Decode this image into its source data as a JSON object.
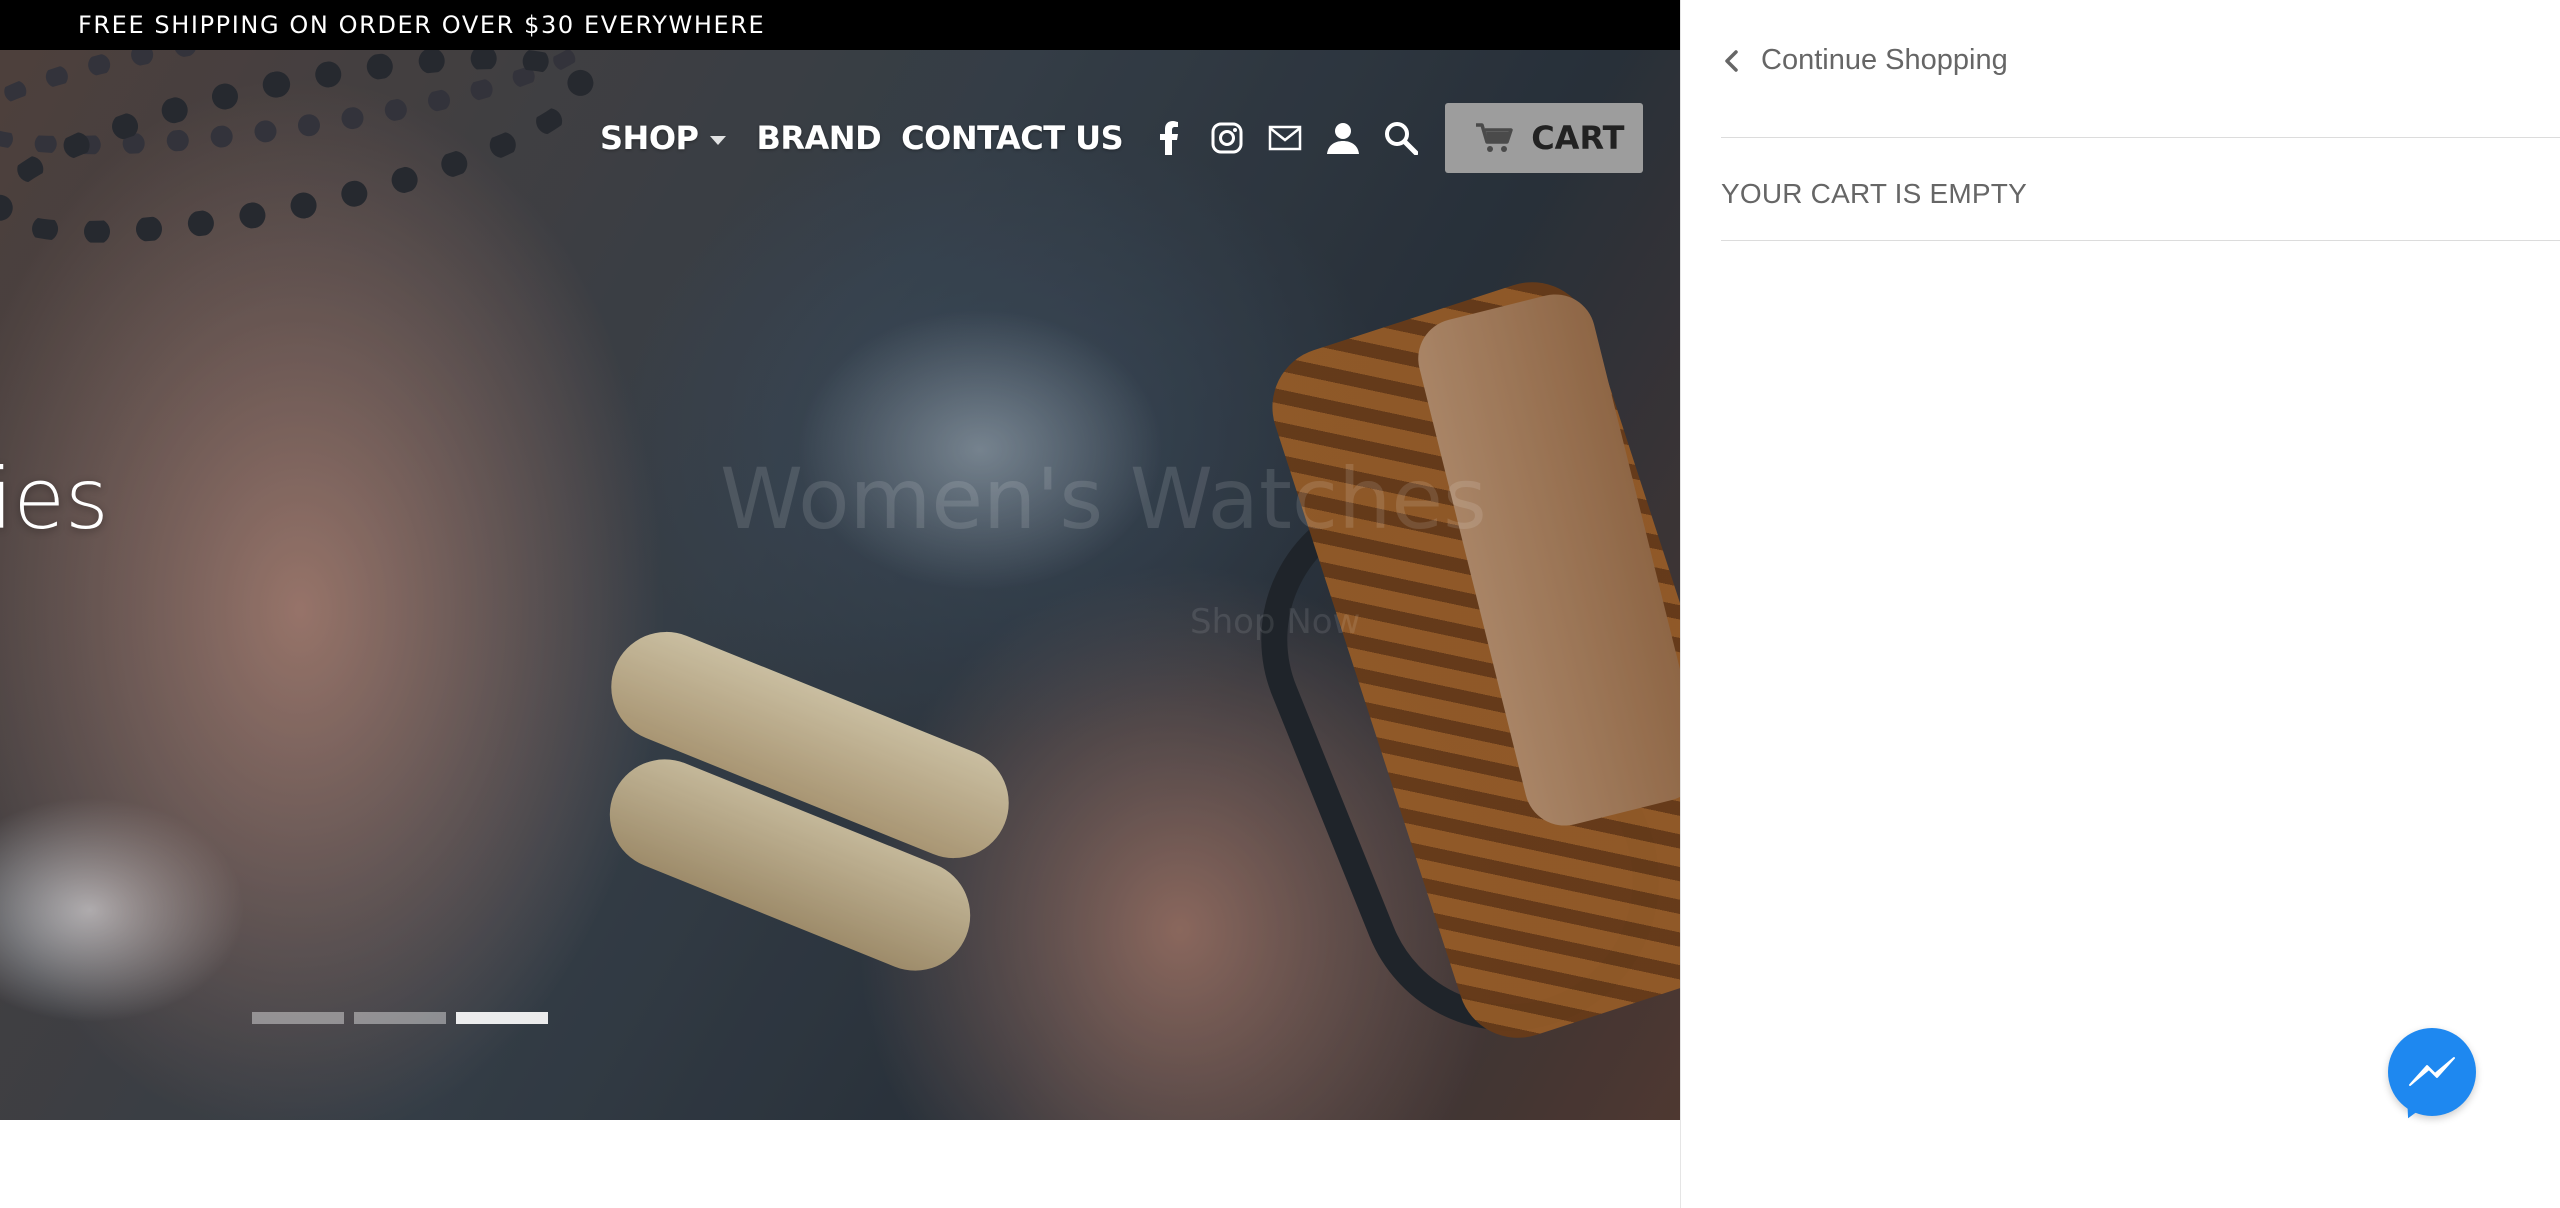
{
  "announcement": {
    "text": "FREE SHIPPING ON ORDER OVER $30 EVERYWHERE"
  },
  "hero": {
    "slide_title": "ies",
    "ghost_title": "Women's Watches",
    "ghost_subtitle": "Shop Now",
    "slides_count": 3,
    "active_slide_index": 2
  },
  "nav": {
    "shop_label": "SHOP",
    "brand_label": "BRAND",
    "contact_label": "CONTACT US",
    "icons": [
      "facebook-icon",
      "instagram-icon",
      "mail-icon",
      "account-icon",
      "search-icon"
    ],
    "cart_label": "CART"
  },
  "drawer": {
    "continue_label": "Continue Shopping",
    "empty_message": "YOUR CART IS EMPTY"
  },
  "colors": {
    "announcement_bg": "#000000",
    "cart_button_bg": "#9d9d9d",
    "messenger_blue": "#1e88f0",
    "drawer_text": "#666666"
  }
}
